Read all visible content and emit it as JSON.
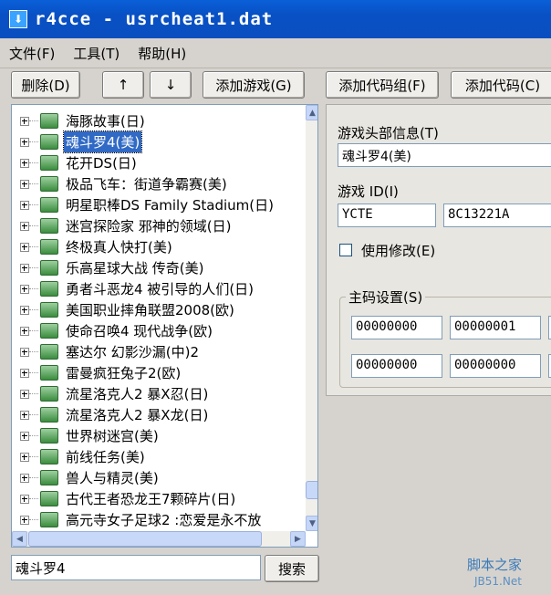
{
  "window": {
    "title": "r4cce - usrcheat1.dat"
  },
  "menu": [
    "文件(F)",
    "工具(T)",
    "帮助(H)"
  ],
  "toolbar": {
    "delete": "删除(D)",
    "up": "↑",
    "down": "↓",
    "add_game": "添加游戏(G)",
    "add_code_group": "添加代码组(F)",
    "add_code": "添加代码(C)"
  },
  "tree": {
    "items": [
      "海豚故事(日)",
      "魂斗罗4(美)",
      "花开DS(日)",
      "极品飞车：街道争霸赛(美)",
      "明星职棒DS Family Stadium(日)",
      "迷宫探险家 邪神的领域(日)",
      "终极真人快打(美)",
      "乐高星球大战 传奇(美)",
      "勇者斗恶龙4 被引导的人们(日)",
      "美国职业摔角联盟2008(欧)",
      "使命召唤4 现代战争(欧)",
      "塞达尔 幻影沙漏(中)2",
      "雷曼疯狂兔子2(欧)",
      "流星洛克人2 暴X忍(日)",
      "流星洛克人2 暴X龙(日)",
      "世界树迷宫(美)",
      "前线任务(美)",
      "兽人与精灵(美)",
      "古代王者恐龙王7颗碎片(日)",
      "高元寺女子足球2 :恋爱是永不放"
    ],
    "selected_index": 1
  },
  "search": {
    "value": "魂斗罗4",
    "button": "搜索"
  },
  "details": {
    "header_label": "游戏头部信息(T)",
    "header_value": "魂斗罗4(美)",
    "game_id_label": "游戏 ID(I)",
    "game_id_value": "YCTE",
    "game_crc_value": "8C13221A",
    "use_modify_label": "使用修改(E)",
    "use_modify_checked": false,
    "master_code_label": "主码设置(S)",
    "master_codes": [
      "00000000",
      "00000001",
      "00000000",
      "00000000"
    ]
  },
  "watermark": {
    "line1": "脚本之家",
    "line2": "JB51.Net"
  }
}
